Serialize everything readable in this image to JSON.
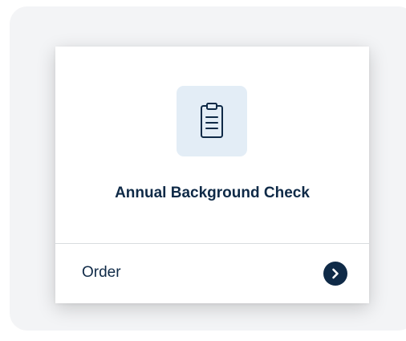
{
  "card": {
    "icon": "clipboard-icon",
    "title": "Annual Background Check",
    "action_label": "Order",
    "action_icon": "chevron-right-circle-icon"
  },
  "colors": {
    "panel_bg": "#f3f4f6",
    "card_bg": "#ffffff",
    "icon_tile_bg": "#e3edf6",
    "text_primary": "#0f2a47",
    "divider": "#d9dcdf"
  }
}
